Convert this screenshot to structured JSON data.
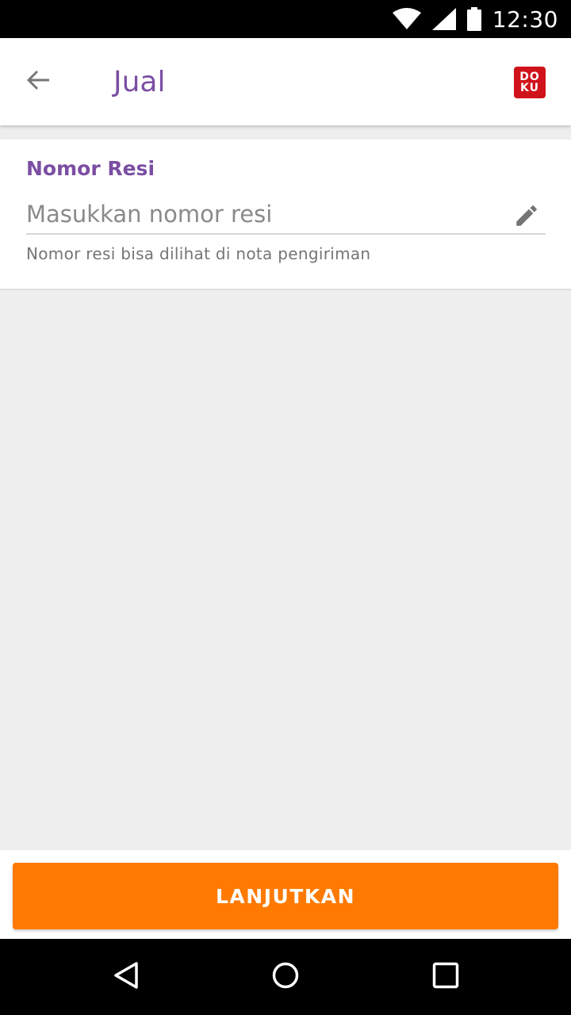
{
  "status_bar": {
    "time": "12:30",
    "icons": [
      "wifi-icon",
      "signal-icon",
      "battery-icon"
    ]
  },
  "app_bar": {
    "title": "Jual",
    "back_icon": "arrow-left-icon",
    "logo_line1": "DO",
    "logo_line2": "KU"
  },
  "form": {
    "label": "Nomor Resi",
    "input_value": "",
    "input_placeholder": "Masukkan nomor resi",
    "helper": "Nomor resi bisa dilihat di nota pengiriman",
    "edit_icon": "pencil-icon"
  },
  "actions": {
    "continue_label": "LANJUTKAN"
  },
  "nav_bar": {
    "icons": [
      "back-triangle-icon",
      "home-circle-icon",
      "recents-square-icon"
    ]
  },
  "colors": {
    "accent_purple": "#7b4ea3",
    "button_orange": "#ff7a00",
    "logo_red": "#d0121b",
    "background_gray": "#eeeeee"
  }
}
